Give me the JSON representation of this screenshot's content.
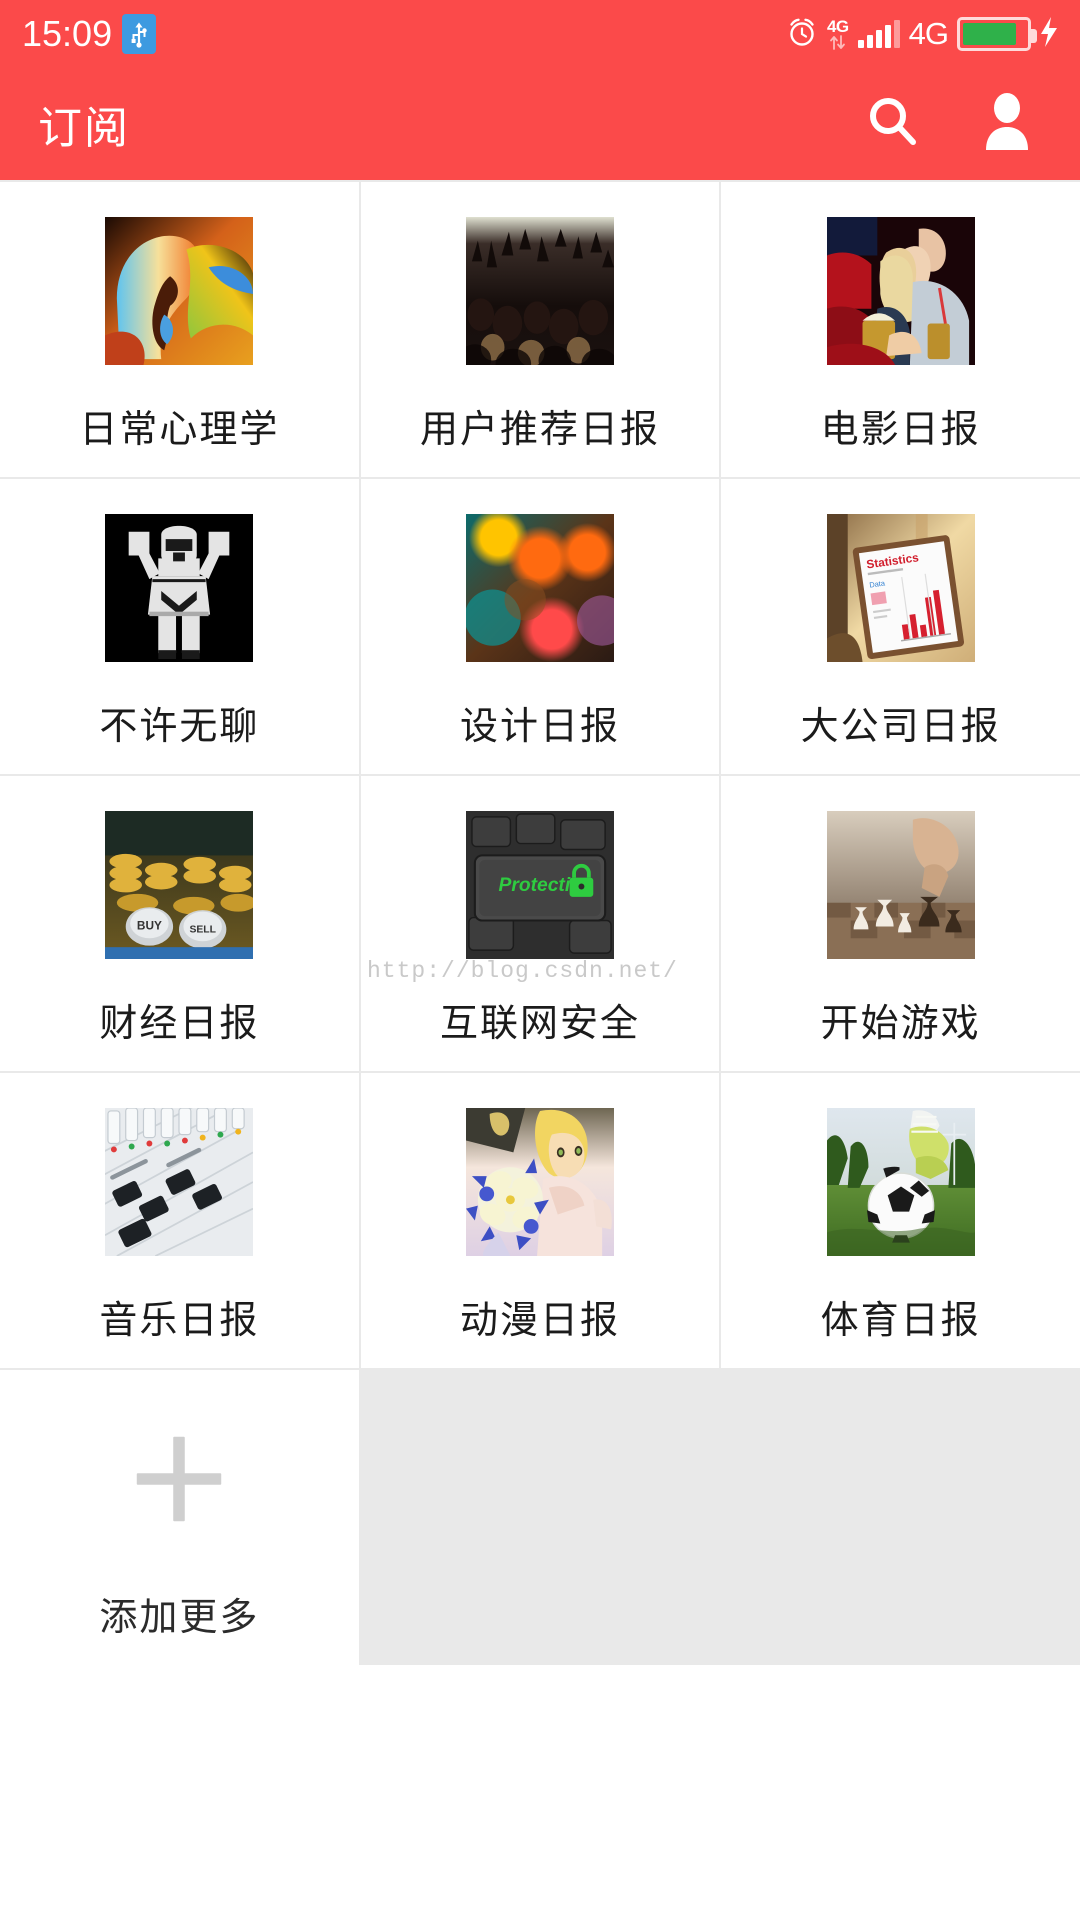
{
  "status_bar": {
    "time": "15:09",
    "usb_icon": "usb-icon",
    "alarm_icon": "alarm-clock-icon",
    "data_small_label": "4G",
    "network_label": "4G",
    "signal_icon": "signal-bars-icon",
    "battery_icon": "battery-charging-icon",
    "battery_level_percent": 86,
    "accent_color": "#fb4a4a",
    "battery_fill_color": "#2fb14a",
    "usb_badge_color": "#3d9ae0"
  },
  "app_bar": {
    "title": "订阅",
    "actions": [
      {
        "name": "search-button",
        "icon": "search-icon"
      },
      {
        "name": "profile-button",
        "icon": "person-icon"
      }
    ]
  },
  "watermark": {
    "text": "http://blog.csdn.net/"
  },
  "grid": {
    "columns": 3,
    "items": [
      {
        "label": "日常心理学",
        "thumb": "abstract-face-art"
      },
      {
        "label": "用户推荐日报",
        "thumb": "concert-crowd"
      },
      {
        "label": "电影日报",
        "thumb": "cinema-couple"
      },
      {
        "label": "不许无聊",
        "thumb": "stormtrooper"
      },
      {
        "label": "设计日报",
        "thumb": "bokeh-lights"
      },
      {
        "label": "大公司日报",
        "thumb": "tablet-statistics"
      },
      {
        "label": "财经日报",
        "thumb": "coins-buy-sell"
      },
      {
        "label": "互联网安全",
        "thumb": "keyboard-protection-key"
      },
      {
        "label": "开始游戏",
        "thumb": "chess-board"
      },
      {
        "label": "音乐日报",
        "thumb": "audio-mixer"
      },
      {
        "label": "动漫日报",
        "thumb": "anime-girl-flowers"
      },
      {
        "label": "体育日报",
        "thumb": "soccer-ball-grass"
      }
    ],
    "add_more": {
      "label": "添加更多",
      "icon": "plus-icon"
    }
  }
}
